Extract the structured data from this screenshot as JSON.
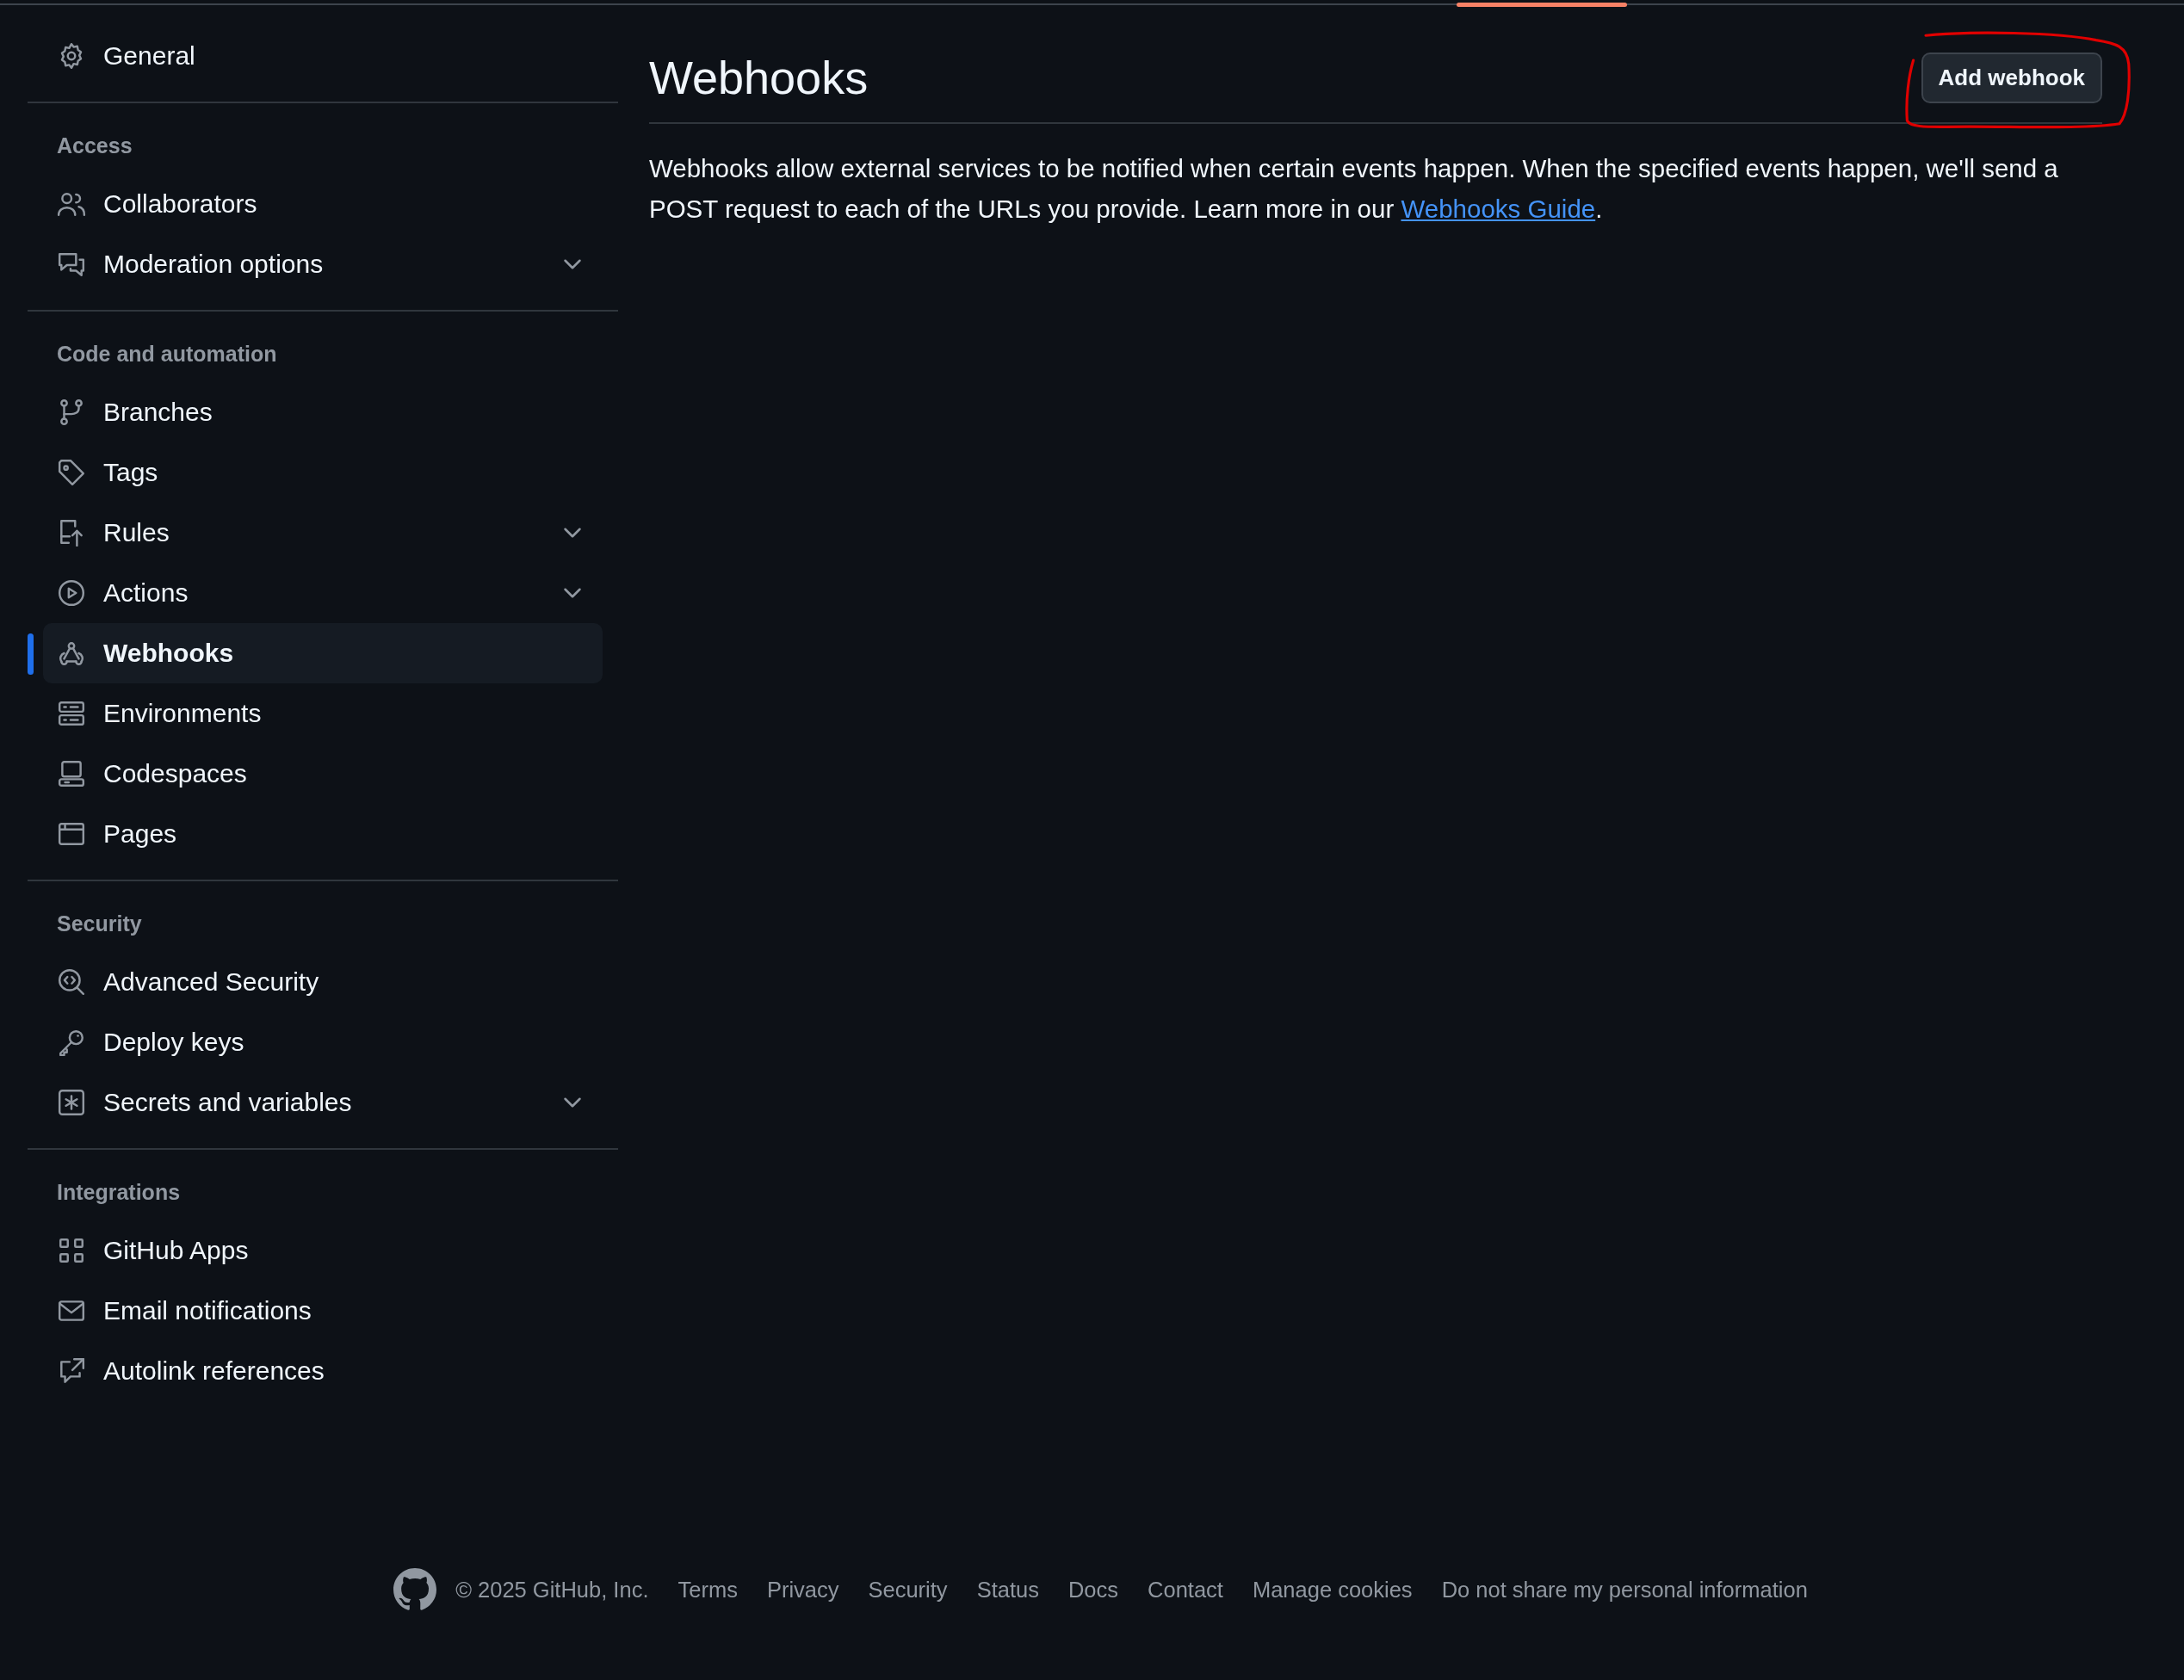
{
  "sidebar": {
    "sections": [
      {
        "items": [
          {
            "label": "General",
            "expandable": false,
            "selected": false
          }
        ]
      },
      {
        "heading": "Access",
        "items": [
          {
            "label": "Collaborators",
            "expandable": false,
            "selected": false
          },
          {
            "label": "Moderation options",
            "expandable": true,
            "selected": false
          }
        ]
      },
      {
        "heading": "Code and automation",
        "items": [
          {
            "label": "Branches",
            "expandable": false,
            "selected": false
          },
          {
            "label": "Tags",
            "expandable": false,
            "selected": false
          },
          {
            "label": "Rules",
            "expandable": true,
            "selected": false
          },
          {
            "label": "Actions",
            "expandable": true,
            "selected": false
          },
          {
            "label": "Webhooks",
            "expandable": false,
            "selected": true
          },
          {
            "label": "Environments",
            "expandable": false,
            "selected": false
          },
          {
            "label": "Codespaces",
            "expandable": false,
            "selected": false
          },
          {
            "label": "Pages",
            "expandable": false,
            "selected": false
          }
        ]
      },
      {
        "heading": "Security",
        "items": [
          {
            "label": "Advanced Security",
            "expandable": false,
            "selected": false
          },
          {
            "label": "Deploy keys",
            "expandable": false,
            "selected": false
          },
          {
            "label": "Secrets and variables",
            "expandable": true,
            "selected": false
          }
        ]
      },
      {
        "heading": "Integrations",
        "items": [
          {
            "label": "GitHub Apps",
            "expandable": false,
            "selected": false
          },
          {
            "label": "Email notifications",
            "expandable": false,
            "selected": false
          },
          {
            "label": "Autolink references",
            "expandable": false,
            "selected": false
          }
        ]
      }
    ]
  },
  "main": {
    "title": "Webhooks",
    "add_button": "Add webhook",
    "description": {
      "text": "Webhooks allow external services to be notified when certain events happen. When the specified events happen, we'll send a POST request to each of the URLs you provide. Learn more in our ",
      "link": "Webhooks Guide",
      "after": "."
    }
  },
  "footer": {
    "copyright": "© 2025 GitHub, Inc.",
    "links": [
      "Terms",
      "Privacy",
      "Security",
      "Status",
      "Docs",
      "Contact",
      "Manage cookies",
      "Do not share my personal information"
    ]
  }
}
